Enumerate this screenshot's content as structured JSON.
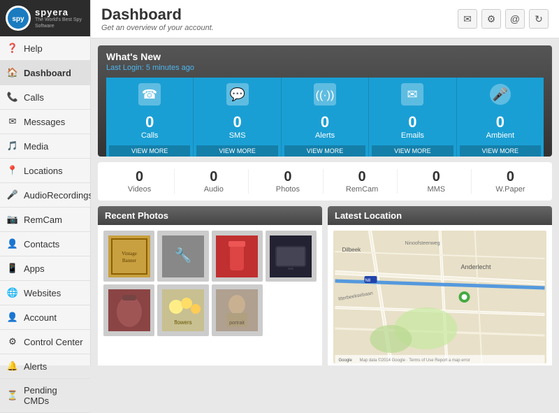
{
  "logo": {
    "circle_text": "spy",
    "brand": "spyera",
    "tagline": "The World's Best Spy Software"
  },
  "sidebar": {
    "items": [
      {
        "id": "help",
        "label": "Help",
        "icon": "❓"
      },
      {
        "id": "dashboard",
        "label": "Dashboard",
        "icon": "🏠",
        "active": true
      },
      {
        "id": "calls",
        "label": "Calls",
        "icon": "📞"
      },
      {
        "id": "messages",
        "label": "Messages",
        "icon": "✉"
      },
      {
        "id": "media",
        "label": "Media",
        "icon": "🎵"
      },
      {
        "id": "locations",
        "label": "Locations",
        "icon": "📍"
      },
      {
        "id": "audio-recordings",
        "label": "AudioRecordings",
        "icon": "🎤"
      },
      {
        "id": "remcam",
        "label": "RemCam",
        "icon": "📷"
      },
      {
        "id": "contacts",
        "label": "Contacts",
        "icon": "👤"
      },
      {
        "id": "apps",
        "label": "Apps",
        "icon": "📱"
      },
      {
        "id": "websites",
        "label": "Websites",
        "icon": "🌐"
      },
      {
        "id": "account",
        "label": "Account",
        "icon": "👤"
      },
      {
        "id": "control-center",
        "label": "Control Center",
        "icon": "⚙"
      },
      {
        "id": "alerts",
        "label": "Alerts",
        "icon": "🔔"
      },
      {
        "id": "pending-cmds",
        "label": "Pending CMDs",
        "icon": "⏳"
      }
    ]
  },
  "header": {
    "title": "Dashboard",
    "subtitle": "Get an overview of your account.",
    "icons": [
      "email-icon",
      "settings-icon",
      "at-icon",
      "refresh-icon"
    ]
  },
  "whats_new": {
    "title": "What's New",
    "last_login_label": "Last Login:",
    "last_login_value": "5 minutes ago"
  },
  "stats": [
    {
      "label": "Calls",
      "value": "0",
      "view_more": "VIEW MORE",
      "icon": "phone"
    },
    {
      "label": "SMS",
      "value": "0",
      "view_more": "VIEW MORE",
      "icon": "sms"
    },
    {
      "label": "Alerts",
      "value": "0",
      "view_more": "VIEW MORE",
      "icon": "wifi"
    },
    {
      "label": "Emails",
      "value": "0",
      "view_more": "VIEW MORE",
      "icon": "email"
    },
    {
      "label": "Ambient",
      "value": "0",
      "view_more": "VIEW MORE",
      "icon": "mic"
    }
  ],
  "secondary_stats": [
    {
      "label": "Videos",
      "value": "0"
    },
    {
      "label": "Audio",
      "value": "0"
    },
    {
      "label": "Photos",
      "value": "0"
    },
    {
      "label": "RemCam",
      "value": "0"
    },
    {
      "label": "MMS",
      "value": "0"
    },
    {
      "label": "W.Paper",
      "value": "0"
    }
  ],
  "recent_photos": {
    "title": "Recent Photos",
    "photos": [
      {
        "id": "vintage",
        "style": "photo-vintage",
        "label": "Vintage Banner"
      },
      {
        "id": "tools",
        "style": "photo-tools",
        "label": "Tools"
      },
      {
        "id": "bottle",
        "style": "photo-bottle",
        "label": "Bottle"
      },
      {
        "id": "tablet",
        "style": "photo-tablet",
        "label": "Tablet"
      },
      {
        "id": "bag",
        "style": "photo-bag",
        "label": "Bag"
      },
      {
        "id": "flowers",
        "style": "photo-flowers",
        "label": "Flowers"
      },
      {
        "id": "portrait",
        "style": "photo-portrait",
        "label": "Portrait"
      }
    ]
  },
  "latest_location": {
    "title": "Latest Location",
    "map_label": "Anderlecht",
    "map_sublabel": "Dilbeek",
    "attribution": "Map data ©2014 Google · Terms of Use Report a map error"
  }
}
